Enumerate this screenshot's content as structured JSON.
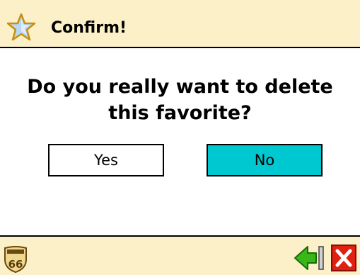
{
  "dialog": {
    "title": "Confirm!",
    "message": "Do you really want to delete this favorite?",
    "yes_label": "Yes",
    "no_label": "No"
  },
  "footer": {
    "logo_label": "66"
  },
  "colors": {
    "bar_background": "#fcf0c8",
    "selected_button": "#00c8d0",
    "back_arrow": "#38b818",
    "close_button": "#e02010"
  },
  "icons": {
    "title": "star-icon",
    "logo": "route-66-shield-icon",
    "back": "back-arrow-icon",
    "close": "close-icon"
  }
}
